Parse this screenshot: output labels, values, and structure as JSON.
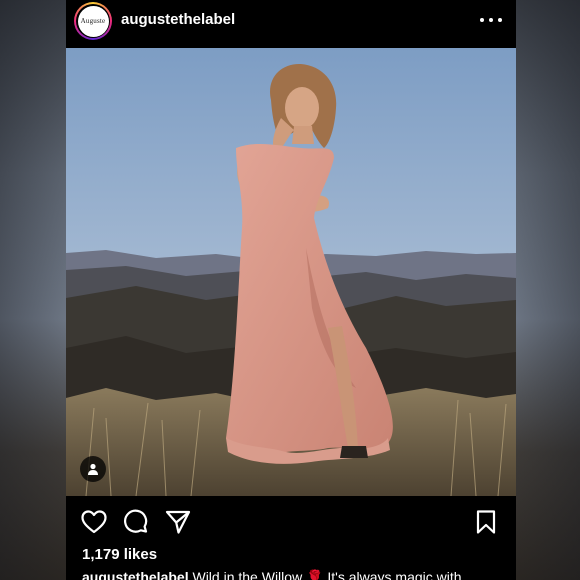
{
  "post": {
    "username": "augustethelabel",
    "avatar_text": "Auguste",
    "likes": "1,179 likes",
    "caption_user": "augustethelabel",
    "caption_text": " Wild in the Willow 🌹 It's always magic with"
  },
  "icons": {
    "more": "more-options-icon",
    "like": "heart-icon",
    "comment": "comment-icon",
    "share": "send-icon",
    "save": "bookmark-icon",
    "tag": "user-tag-icon"
  },
  "colors": {
    "background": "#000000",
    "text": "#ffffff",
    "story_ring": [
      "#f9ce34",
      "#ee2a7b",
      "#6228d7"
    ]
  }
}
